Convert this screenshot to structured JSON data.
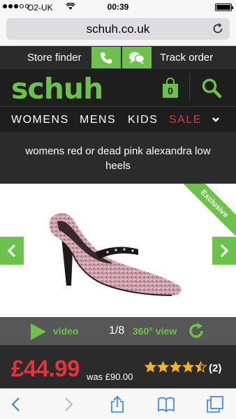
{
  "status_bar": {
    "carrier": "O2-UK",
    "signal": "3 of 5 bars",
    "time": "00:39",
    "battery": "full"
  },
  "browser": {
    "url": "schuh.co.uk",
    "icons": [
      "reload-icon",
      "back-icon",
      "forward-icon",
      "share-icon",
      "bookmarks-icon",
      "tabs-icon"
    ]
  },
  "top_nav": {
    "store_finder": "Store finder",
    "track_order": "Track order",
    "icons": [
      "phone-icon",
      "chat-icon"
    ]
  },
  "header": {
    "logo": "schuh",
    "basket_count": "0",
    "icons": [
      "basket-icon",
      "search-icon"
    ]
  },
  "categories": {
    "womens": "WOMENS",
    "mens": "MENS",
    "kids": "KIDS",
    "sale": "SALE"
  },
  "product": {
    "title": "womens red or dead pink alexandra low heels",
    "badge": "Exclusive",
    "image_counter": "1/8",
    "video_label": "video",
    "view360_label": "360° view",
    "price": "£44.99",
    "was_price": "was £90.00",
    "rating": 4.5,
    "rating_max": 5,
    "review_count": "(2)"
  },
  "colors": {
    "brand_green": "#6cc24a",
    "sale_red": "#e6323c",
    "dark_bg": "#1e1e1e",
    "bar_bg": "#2b2b2b",
    "ios_blue": "#2f7ef5"
  }
}
